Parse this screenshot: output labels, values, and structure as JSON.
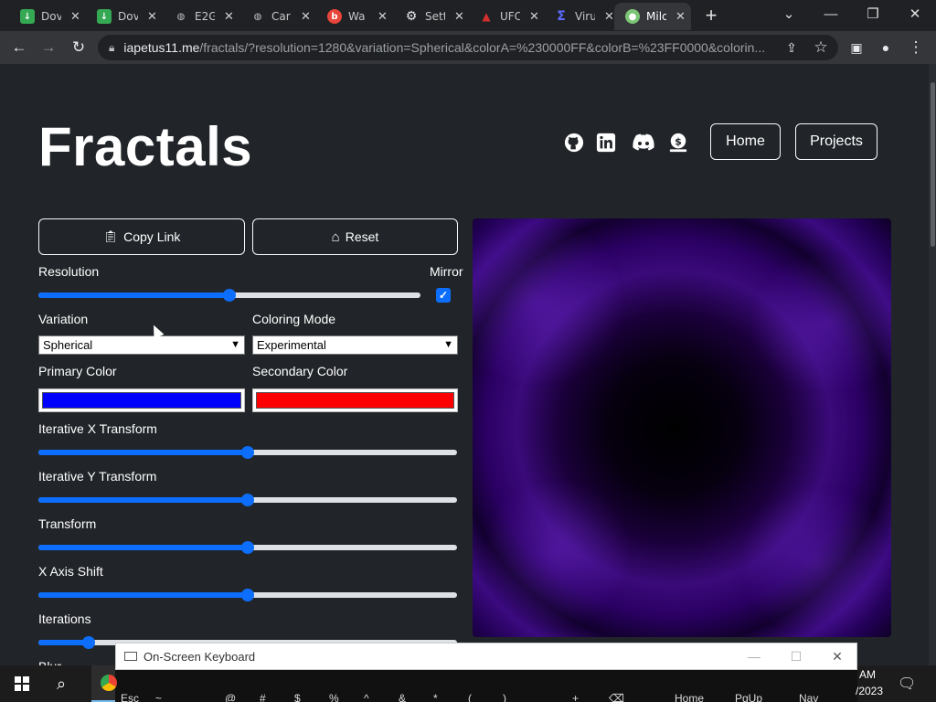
{
  "browser": {
    "tabs": [
      {
        "label": "Dov",
        "icon": "download-icon",
        "color": "#34a853"
      },
      {
        "label": "Dov",
        "icon": "download-icon",
        "color": "#34a853"
      },
      {
        "label": "E2G",
        "icon": "globe-icon",
        "color": "#9aa0a6"
      },
      {
        "label": "Car",
        "icon": "globe-icon",
        "color": "#9aa0a6"
      },
      {
        "label": "Wa",
        "icon": "brand-icon",
        "color": "#e8453c"
      },
      {
        "label": "Sett",
        "icon": "gear-icon",
        "color": "#e8eaed"
      },
      {
        "label": "UFC",
        "icon": "ufc-icon",
        "color": "#d32f2f"
      },
      {
        "label": "Viru",
        "icon": "sigma-icon",
        "color": "#5b6cff"
      },
      {
        "label": "Milc",
        "icon": "leaf-icon",
        "color": "#7cc576",
        "active": true
      }
    ],
    "url_host": "iapetus11.me",
    "url_path": "/fractals/?resolution=1280&variation=Spherical&colorA=%230000FF&colorB=%23FF0000&colorin..."
  },
  "header": {
    "title": "Fractals",
    "nav": {
      "home_label": "Home",
      "projects_label": "Projects"
    },
    "social_icons": [
      "github-icon",
      "linkedin-icon",
      "discord-icon",
      "donate-icon"
    ]
  },
  "controls": {
    "copy_link_label": "Copy Link",
    "reset_label": "Reset",
    "resolution_label": "Resolution",
    "mirror_label": "Mirror",
    "mirror_checked": true,
    "variation_label": "Variation",
    "variation_value": "Spherical",
    "coloring_mode_label": "Coloring Mode",
    "coloring_mode_value": "Experimental",
    "primary_color_label": "Primary Color",
    "primary_color": "#0000FF",
    "secondary_color_label": "Secondary Color",
    "secondary_color": "#FF0000",
    "iter_x_label": "Iterative X Transform",
    "iter_y_label": "Iterative Y Transform",
    "transform_label": "Transform",
    "x_shift_label": "X Axis Shift",
    "iterations_label": "Iterations",
    "next_label": "Blur"
  },
  "sliders": {
    "resolution": 0.5,
    "iter_x": 0.5,
    "iter_y": 0.5,
    "transform": 0.5,
    "x_shift": 0.5,
    "iterations": 0.12
  },
  "osk": {
    "title": "On-Screen Keyboard",
    "keys": [
      "Esc",
      "~",
      "!",
      "@",
      "#",
      "$",
      "%",
      "^",
      "&",
      "*",
      "(",
      ")",
      "_",
      "+",
      "⌫",
      "Home",
      "PgUp",
      "Nav"
    ]
  },
  "taskbar": {
    "time": "AM",
    "date": "/2023"
  },
  "accent": "#0d6efd"
}
